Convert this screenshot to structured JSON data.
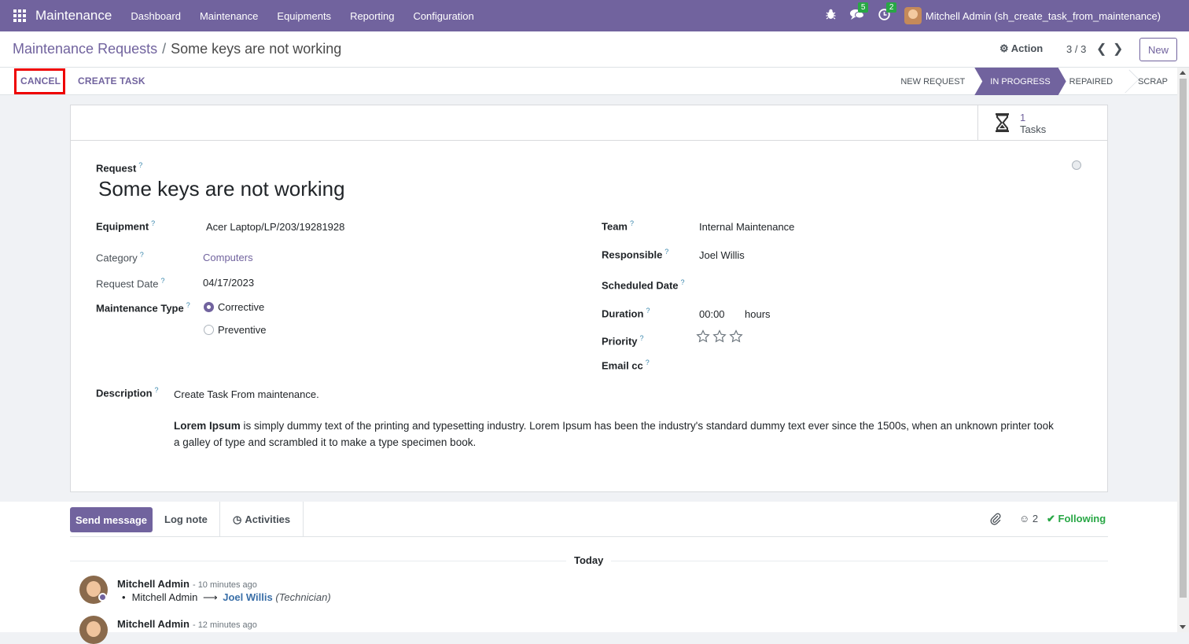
{
  "topnav": {
    "app_title": "Maintenance",
    "menu": [
      "Dashboard",
      "Maintenance",
      "Equipments",
      "Reporting",
      "Configuration"
    ],
    "messages_badge": "5",
    "activities_badge": "2",
    "user": "Mitchell Admin (sh_create_task_from_maintenance)"
  },
  "control": {
    "breadcrumb_parent": "Maintenance Requests",
    "breadcrumb_sep": "/",
    "breadcrumb_current": "Some keys are not working",
    "action_label": "Action",
    "pager": "3 / 3",
    "new_label": "New"
  },
  "statusbar": {
    "cancel_label": "CANCEL",
    "create_task_label": "CREATE TASK",
    "stages": [
      "NEW REQUEST",
      "IN PROGRESS",
      "REPAIRED",
      "SCRAP"
    ],
    "active_stage": "IN PROGRESS"
  },
  "smart_button": {
    "count": "1",
    "label": "Tasks"
  },
  "form": {
    "request_label": "Request",
    "title": "Some keys are not working",
    "equipment_label": "Equipment",
    "equipment": "Acer Laptop/LP/203/19281928",
    "category_label": "Category",
    "category": "Computers",
    "request_date_label": "Request Date",
    "request_date": "04/17/2023",
    "maintenance_type_label": "Maintenance Type",
    "type_options": [
      "Corrective",
      "Preventive"
    ],
    "type_selected": "Corrective",
    "team_label": "Team",
    "team": "Internal Maintenance",
    "responsible_label": "Responsible",
    "responsible": "Joel Willis",
    "scheduled_date_label": "Scheduled Date",
    "duration_label": "Duration",
    "duration": "00:00",
    "duration_unit": "hours",
    "priority_label": "Priority",
    "priority_stars": 0,
    "email_cc_label": "Email cc",
    "description_label": "Description",
    "description_line1": "Create Task From maintenance.",
    "description_bold": "Lorem Ipsum",
    "description_rest": " is simply dummy text of the printing and typesetting industry. Lorem Ipsum has been the industry's standard dummy text ever since the 1500s, when an unknown printer took a galley of type and scrambled it to make a type specimen book."
  },
  "chatter": {
    "send_message": "Send message",
    "log_note": "Log note",
    "activities": "Activities",
    "followers_count": "2",
    "following": "Following",
    "today": "Today",
    "messages": [
      {
        "author": "Mitchell Admin",
        "time": "- 10 minutes ago",
        "old": "Mitchell Admin",
        "new": "Joel Willis",
        "field": "(Technician)"
      },
      {
        "author": "Mitchell Admin",
        "time": "- 12 minutes ago"
      }
    ]
  },
  "colors": {
    "brand": "#71639e",
    "cancel_highlight": "#ee0000",
    "following": "#28a745"
  }
}
